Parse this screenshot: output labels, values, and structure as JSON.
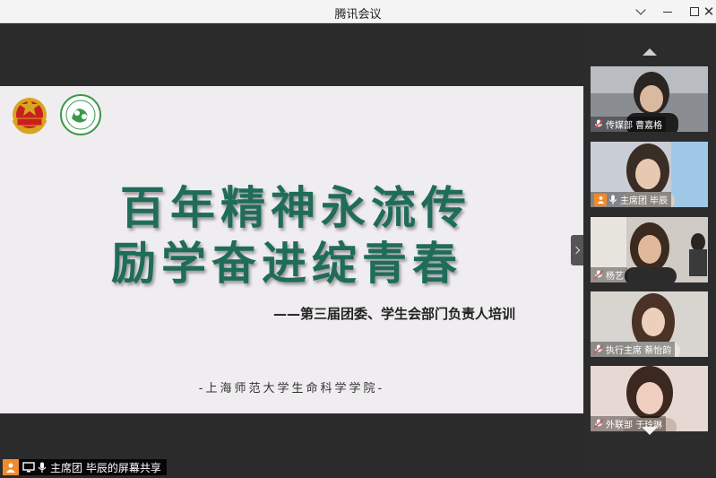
{
  "window": {
    "title": "腾讯会议",
    "minimize_label": "最小化",
    "maximize_label": "最大化",
    "close_label": "关闭"
  },
  "slide": {
    "headline_line1": "百年精神永流传",
    "headline_line2": "励学奋进绽青春",
    "subtitle": "——第三届团委、学生会部门负责人培训",
    "school": "-上海师范大学生命科学学院-"
  },
  "share_bar": {
    "text": "主席团 毕辰的屏幕共享"
  },
  "participants": [
    {
      "name": "传媒部 曹嘉格",
      "host": false
    },
    {
      "name": "主席团 毕辰",
      "host": true
    },
    {
      "name": "杨艺",
      "host": false
    },
    {
      "name": "执行主席 蔡怡韵",
      "host": false
    },
    {
      "name": "外联部 于玲琳",
      "host": false
    }
  ],
  "colors": {
    "headline": "#1f6c5a",
    "host_badge": "#f08a2b",
    "slide_bg": "#efedef"
  }
}
